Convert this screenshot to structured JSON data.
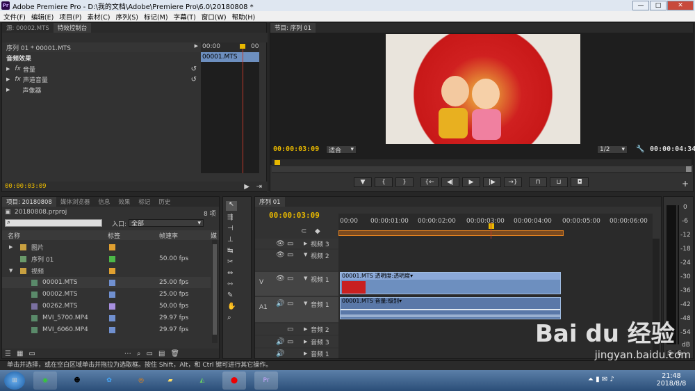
{
  "window": {
    "title": "Adobe Premiere Pro - D:\\我的文档\\Adobe\\Premiere Pro\\6.0\\20180808 *",
    "logo": "Pr",
    "min": "—",
    "max": "□",
    "close": "✕"
  },
  "menu": [
    "文件(F)",
    "编辑(E)",
    "项目(P)",
    "素材(C)",
    "序列(S)",
    "标记(M)",
    "字幕(T)",
    "窗口(W)",
    "帮助(H)"
  ],
  "effect_panel": {
    "tabs": [
      "源: 00002.MTS",
      "特效控制台"
    ],
    "seq_label": "序列 01 * 00001.MTS",
    "ruler_start": "00:00",
    "ruler_end": "00",
    "clip_name": "00001.MTS",
    "section": "音频效果",
    "items": [
      "音量",
      "声道音量",
      "声像器"
    ],
    "fx": "fx",
    "time": "00:00:03:09"
  },
  "program": {
    "tab": "节目: 序列 01",
    "time_left": "00:00:03:09",
    "fit": "适合",
    "ratio": "1/2",
    "time_right": "00:00:04:34",
    "plus": "+"
  },
  "project": {
    "tabs": [
      "项目: 20180808",
      "媒体浏览器",
      "信息",
      "效果",
      "标记",
      "历史"
    ],
    "file": "20180808.prproj",
    "count": "8 项",
    "entry_label": "入口:",
    "entry_value": "全部",
    "search_placeholder": "",
    "headers": [
      "名称",
      "标签",
      "帧速率",
      "媒"
    ],
    "rows": [
      {
        "name": "图片",
        "label_color": "#e0a030",
        "fps": "",
        "icon": "folder-icon"
      },
      {
        "name": "序列 01",
        "label_color": "#4cb848",
        "fps": "50.00 fps",
        "icon": "sequence-icon"
      },
      {
        "name": "视频",
        "label_color": "#e0a030",
        "fps": "",
        "icon": "folder-icon"
      },
      {
        "name": "00001.MTS",
        "label_color": "#7090d0",
        "fps": "25.00 fps",
        "icon": "clip-icon"
      },
      {
        "name": "00002.MTS",
        "label_color": "#7090d0",
        "fps": "25.00 fps",
        "icon": "clip-icon"
      },
      {
        "name": "00262.MTS",
        "label_color": "#a890e0",
        "fps": "50.00 fps",
        "icon": "clip-icon"
      },
      {
        "name": "MVI_5700.MP4",
        "label_color": "#7090d0",
        "fps": "29.97 fps",
        "icon": "clip-icon"
      },
      {
        "name": "MVI_6060.MP4",
        "label_color": "#7090d0",
        "fps": "29.97 fps",
        "icon": "clip-icon"
      }
    ]
  },
  "timeline": {
    "tab": "序列 01",
    "time": "00:00:03:09",
    "ticks": [
      "00:00",
      "00:00:01:00",
      "00:00:02:00",
      "00:00:03:00",
      "00:00:04:00",
      "00:00:05:00",
      "00:00:06:00"
    ],
    "tracks": [
      {
        "name": "视频 3",
        "side": ""
      },
      {
        "name": "视频 2",
        "side": ""
      },
      {
        "name": "视频 1",
        "side": "V"
      },
      {
        "name": "音频 1",
        "side": "A1"
      },
      {
        "name": "音频 2",
        "side": ""
      },
      {
        "name": "音频 3",
        "side": ""
      },
      {
        "name": "音频 1",
        "side": ""
      }
    ],
    "video_clip": "00001.MTS 透明度:透明度▾",
    "audio_clip": "00001.MTS 音量:级别▾"
  },
  "meter": {
    "labels": [
      "0",
      "-6",
      "-12",
      "-18",
      "-24",
      "-30",
      "-36",
      "-42",
      "-48",
      "-54",
      "dB"
    ],
    "solo": "S"
  },
  "status": "单击并选择，或在空白区域单击并拖拉为选取框。按住 Shift，Alt，和 Ctrl 键可进行其它操作。",
  "taskbar": {
    "time": "21:48",
    "date": "2018/8/8"
  },
  "watermark": {
    "brand": "Bai du 经验",
    "url": "jingyan.baidu.com"
  }
}
